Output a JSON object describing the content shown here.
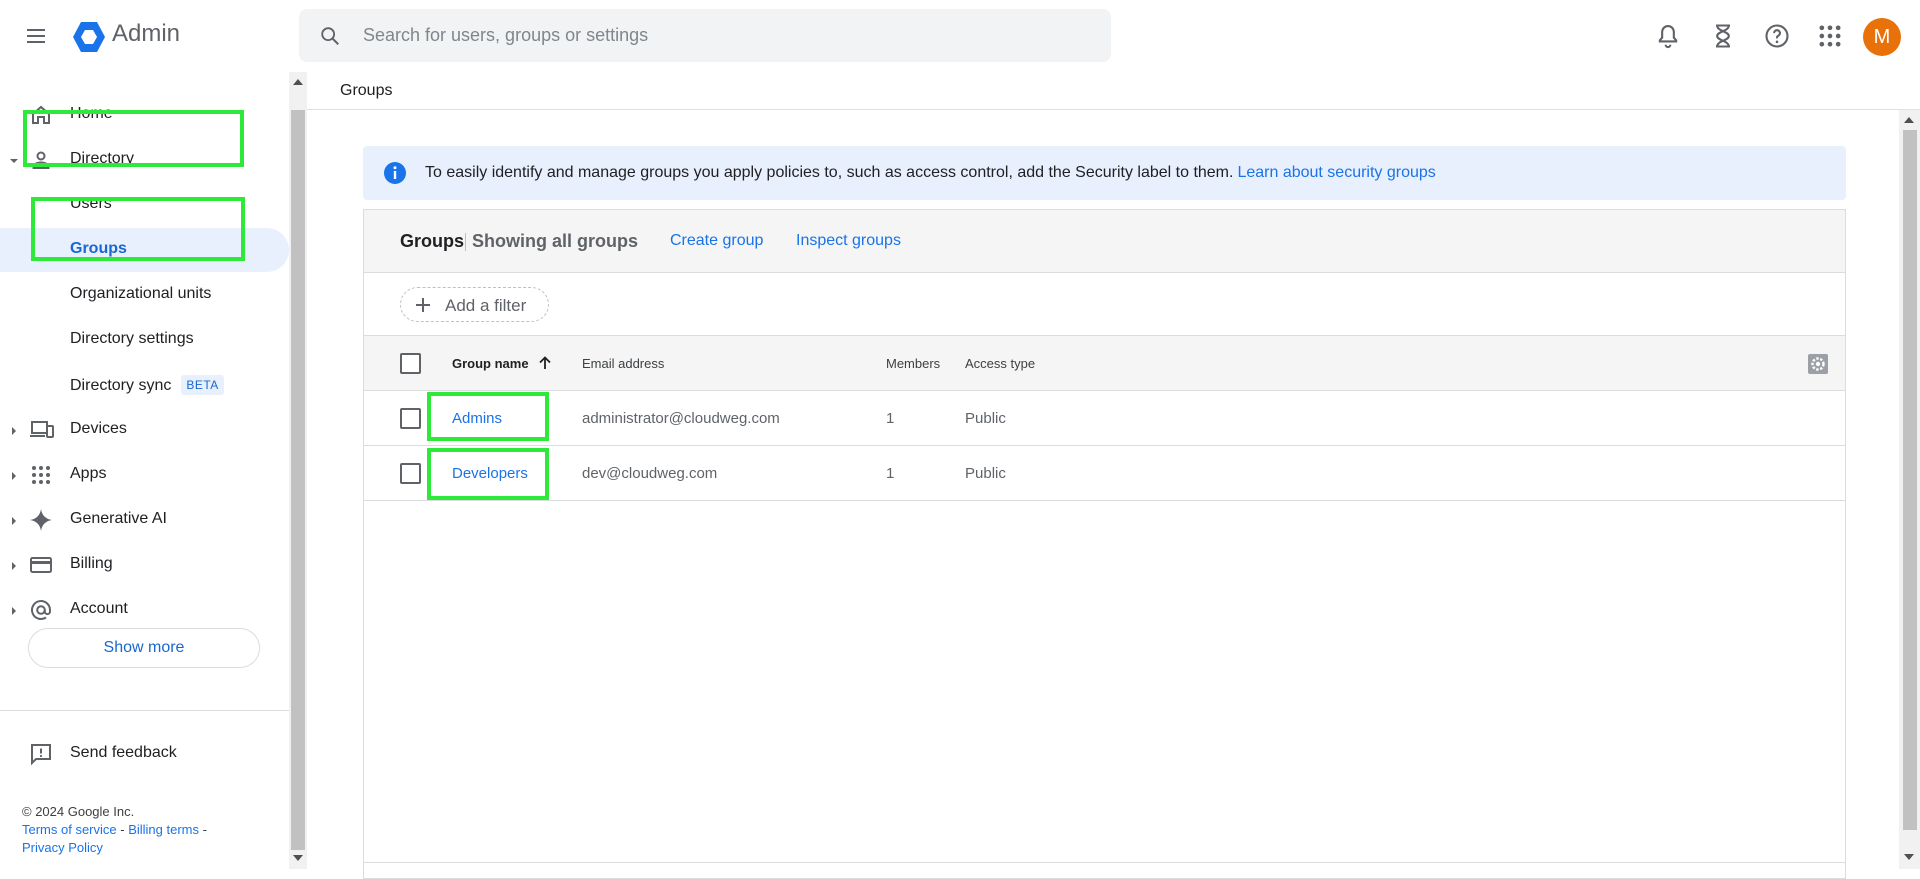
{
  "header": {
    "app_title": "Admin",
    "search_placeholder": "Search for users, groups or settings",
    "avatar_initial": "M",
    "icons": [
      "menu-icon",
      "admin-logo-icon",
      "search-icon",
      "notifications-icon",
      "hourglass-icon",
      "help-icon",
      "apps-grid-icon"
    ],
    "avatar_color": "#e8710a"
  },
  "sidebar": {
    "items": [
      {
        "label": "Home",
        "icon": "home-icon"
      },
      {
        "label": "Directory",
        "icon": "person-icon",
        "expanded": true
      },
      {
        "label": "Users"
      },
      {
        "label": "Groups",
        "active": true
      },
      {
        "label": "Organizational units"
      },
      {
        "label": "Directory settings"
      },
      {
        "label": "Directory sync",
        "badge": "BETA"
      },
      {
        "label": "Devices",
        "icon": "devices-icon"
      },
      {
        "label": "Apps",
        "icon": "apps-icon"
      },
      {
        "label": "Generative AI",
        "icon": "sparkle-icon"
      },
      {
        "label": "Billing",
        "icon": "credit-card-icon"
      },
      {
        "label": "Account",
        "icon": "at-sign-icon"
      }
    ],
    "show_more": "Show more",
    "feedback": "Send feedback",
    "copyright": "© 2024 Google Inc.",
    "terms": "Terms of service",
    "billing_terms": "Billing terms",
    "privacy": "Privacy Policy"
  },
  "main": {
    "breadcrumb": "Groups",
    "info_text": "To easily identify and manage groups you apply policies to, such as access control, add the Security label to them.",
    "info_link": "Learn about security groups",
    "card_title": "Groups",
    "card_subtitle": "Showing all groups",
    "create_group": "Create group",
    "inspect_groups": "Inspect groups",
    "add_filter": "Add a filter",
    "columns": [
      "Group name",
      "Email address",
      "Members",
      "Access type"
    ],
    "rows": [
      {
        "name": "Admins",
        "email": "administrator@cloudweg.com",
        "members": "1",
        "access": "Public"
      },
      {
        "name": "Developers",
        "email": "dev@cloudweg.com",
        "members": "1",
        "access": "Public"
      }
    ]
  },
  "colors": {
    "accent": "#1a73e8",
    "active_bg": "#e8f0fe",
    "highlight": "#2ee83a"
  }
}
